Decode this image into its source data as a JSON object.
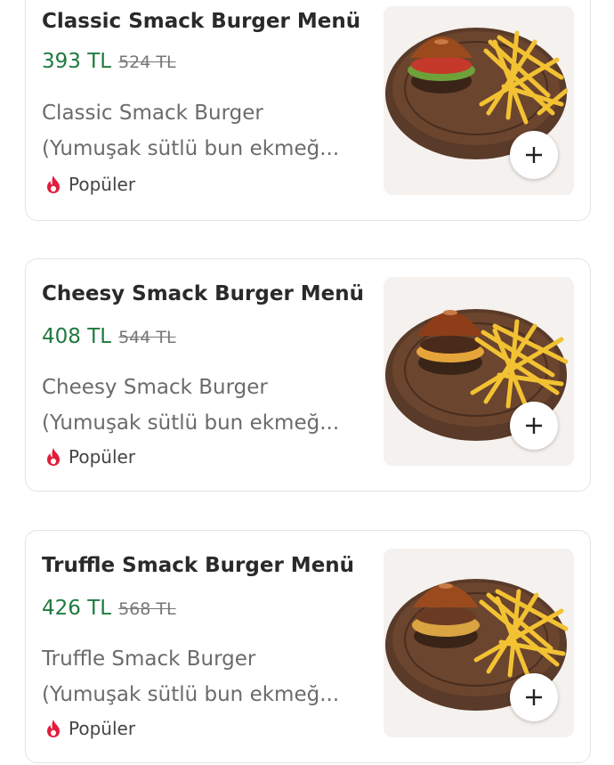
{
  "colors": {
    "price": "#1f7a3f",
    "badge_flame": "#e21d3c"
  },
  "products": [
    {
      "title": "Classic Smack Burger Menü",
      "price": "393 TL",
      "old_price": "524 TL",
      "desc_line1": "Classic Smack Burger",
      "desc_line2": "(Yumuşak sütlü bun ekmeğ...",
      "badge": "Popüler",
      "image_icon": "burger-fries-plate",
      "add_icon": "plus-icon"
    },
    {
      "title": "Cheesy Smack Burger Menü",
      "price": "408 TL",
      "old_price": "544 TL",
      "desc_line1": "Cheesy Smack Burger",
      "desc_line2": "(Yumuşak sütlü bun ekmeğ...",
      "badge": "Popüler",
      "image_icon": "burger-fries-plate",
      "add_icon": "plus-icon"
    },
    {
      "title": "Truffle Smack Burger Menü",
      "price": "426 TL",
      "old_price": "568 TL",
      "desc_line1": "Truffle Smack Burger",
      "desc_line2": "(Yumuşak sütlü bun ekmeğ...",
      "badge": "Popüler",
      "image_icon": "burger-fries-plate",
      "add_icon": "plus-icon"
    }
  ]
}
